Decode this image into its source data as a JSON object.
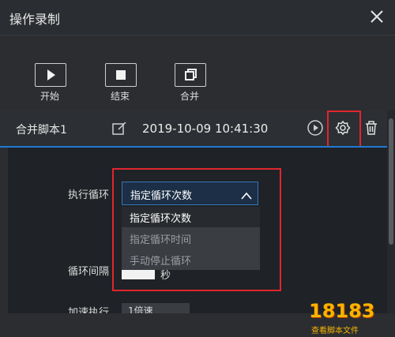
{
  "window": {
    "title": "操作录制",
    "close_icon": "close-icon"
  },
  "toolbar": {
    "buttons": [
      {
        "label": "开始",
        "icon": "play-icon"
      },
      {
        "label": "结束",
        "icon": "stop-icon"
      },
      {
        "label": "合并",
        "icon": "merge-icon"
      }
    ]
  },
  "script": {
    "name": "合并脚本1",
    "datetime": "2019-10-09 10:41:30",
    "icons": [
      "edit-icon",
      "play-icon",
      "settings-icon",
      "trash-icon"
    ]
  },
  "settings": {
    "loop_label": "执行循环",
    "loop_selected": "指定循环次数",
    "loop_options": [
      "指定循环次数",
      "指定循环时间",
      "手动停止循环"
    ],
    "interval_label": "循环间隔",
    "interval_unit": "秒",
    "speed_label": "加速执行",
    "speed_value": "1倍速"
  },
  "watermark": {
    "logo_text": "18183",
    "sub_text": "查看脚本文件"
  },
  "colors": {
    "accent": "#1f7ad6",
    "highlight": "#e0262d",
    "background": "#2b2d31"
  }
}
